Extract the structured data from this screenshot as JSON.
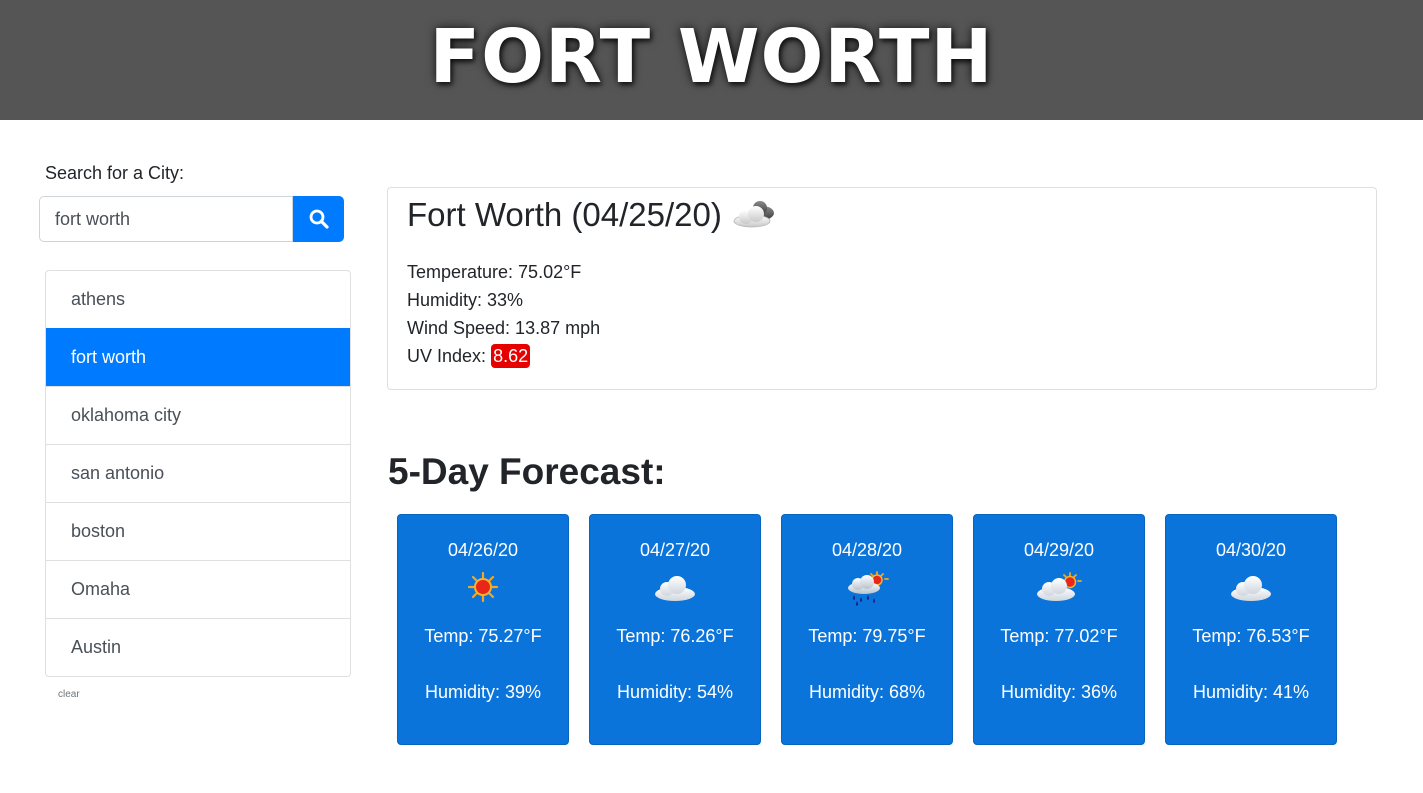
{
  "header": {
    "title": "FORT WORTH"
  },
  "search": {
    "label": "Search for a City:",
    "value": "fort worth"
  },
  "history": {
    "items": [
      {
        "label": "athens",
        "active": false
      },
      {
        "label": "fort worth",
        "active": true
      },
      {
        "label": "oklahoma city",
        "active": false
      },
      {
        "label": "san antonio",
        "active": false
      },
      {
        "label": "boston",
        "active": false
      },
      {
        "label": "Omaha",
        "active": false
      },
      {
        "label": "Austin",
        "active": false
      }
    ],
    "clear_label": "clear"
  },
  "current": {
    "title": "Fort Worth (04/25/20)",
    "icon": "cloudy-night-icon",
    "temperature": "Temperature: 75.02°F",
    "humidity": "Humidity: 33%",
    "wind": "Wind Speed: 13.87 mph",
    "uv_label": "UV Index:",
    "uv_value": "8.62",
    "uv_color": "#e60000"
  },
  "forecast": {
    "title": "5-Day Forecast:",
    "days": [
      {
        "date": "04/26/20",
        "icon": "sun-icon",
        "temp": "Temp: 75.27°F",
        "humidity": "Humidity: 39%"
      },
      {
        "date": "04/27/20",
        "icon": "cloud-icon",
        "temp": "Temp: 76.26°F",
        "humidity": "Humidity: 54%"
      },
      {
        "date": "04/28/20",
        "icon": "rain-sun-icon",
        "temp": "Temp: 79.75°F",
        "humidity": "Humidity: 68%"
      },
      {
        "date": "04/29/20",
        "icon": "partly-cloudy-icon",
        "temp": "Temp: 77.02°F",
        "humidity": "Humidity: 36%"
      },
      {
        "date": "04/30/20",
        "icon": "cloud-icon",
        "temp": "Temp: 76.53°F",
        "humidity": "Humidity: 41%"
      }
    ]
  },
  "colors": {
    "header_bg": "#555555",
    "accent": "#007bff",
    "forecast_card": "#0a74da"
  }
}
